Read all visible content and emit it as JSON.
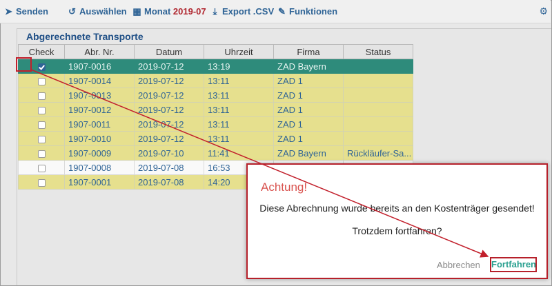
{
  "toolbar": {
    "send": "Senden",
    "select": "Auswählen",
    "month_label": "Monat",
    "month_value": "2019-07",
    "export": "Export .CSV",
    "functions": "Funktionen"
  },
  "panel": {
    "title": "Abgerechnete Transporte"
  },
  "table": {
    "headers": [
      "Check",
      "Abr. Nr.",
      "Datum",
      "Uhrzeit",
      "Firma",
      "Status"
    ],
    "rows": [
      {
        "checked": true,
        "nr": "1907-0016",
        "datum": "2019-07-12",
        "uhrzeit": "13:19",
        "firma": "ZAD Bayern",
        "status": "",
        "style": "selected"
      },
      {
        "checked": false,
        "nr": "1907-0014",
        "datum": "2019-07-12",
        "uhrzeit": "13:11",
        "firma": "ZAD 1",
        "status": "",
        "style": "yellow"
      },
      {
        "checked": false,
        "nr": "1907-0013",
        "datum": "2019-07-12",
        "uhrzeit": "13:11",
        "firma": "ZAD 1",
        "status": "",
        "style": "yellow"
      },
      {
        "checked": false,
        "nr": "1907-0012",
        "datum": "2019-07-12",
        "uhrzeit": "13:11",
        "firma": "ZAD 1",
        "status": "",
        "style": "yellow"
      },
      {
        "checked": false,
        "nr": "1907-0011",
        "datum": "2019-07-12",
        "uhrzeit": "13:11",
        "firma": "ZAD 1",
        "status": "",
        "style": "yellow"
      },
      {
        "checked": false,
        "nr": "1907-0010",
        "datum": "2019-07-12",
        "uhrzeit": "13:11",
        "firma": "ZAD 1",
        "status": "",
        "style": "yellow"
      },
      {
        "checked": false,
        "nr": "1907-0009",
        "datum": "2019-07-10",
        "uhrzeit": "11:41",
        "firma": "ZAD Bayern",
        "status": "Rückläufer-Sa...",
        "style": "yellow"
      },
      {
        "checked": false,
        "nr": "1907-0008",
        "datum": "2019-07-08",
        "uhrzeit": "16:53",
        "firma": "",
        "status": "",
        "style": "white"
      },
      {
        "checked": false,
        "nr": "1907-0001",
        "datum": "2019-07-08",
        "uhrzeit": "14:20",
        "firma": "",
        "status": "",
        "style": "yellow"
      }
    ]
  },
  "dialog": {
    "title": "Achtung!",
    "message": "Diese Abrechnung wurde bereits an den Kostenträger gesendet!",
    "question": "Trotzdem fortfahren?",
    "cancel": "Abbrechen",
    "confirm": "Fortfahren"
  },
  "colors": {
    "accent": "#2f6496",
    "highlight": "#c2202c",
    "selected_row": "#2e8b7b",
    "yellow_row": "#e6e08e"
  },
  "icons": [
    "send-icon",
    "select-icon",
    "calendar-icon",
    "download-icon",
    "wrench-icon",
    "gear-icon"
  ]
}
